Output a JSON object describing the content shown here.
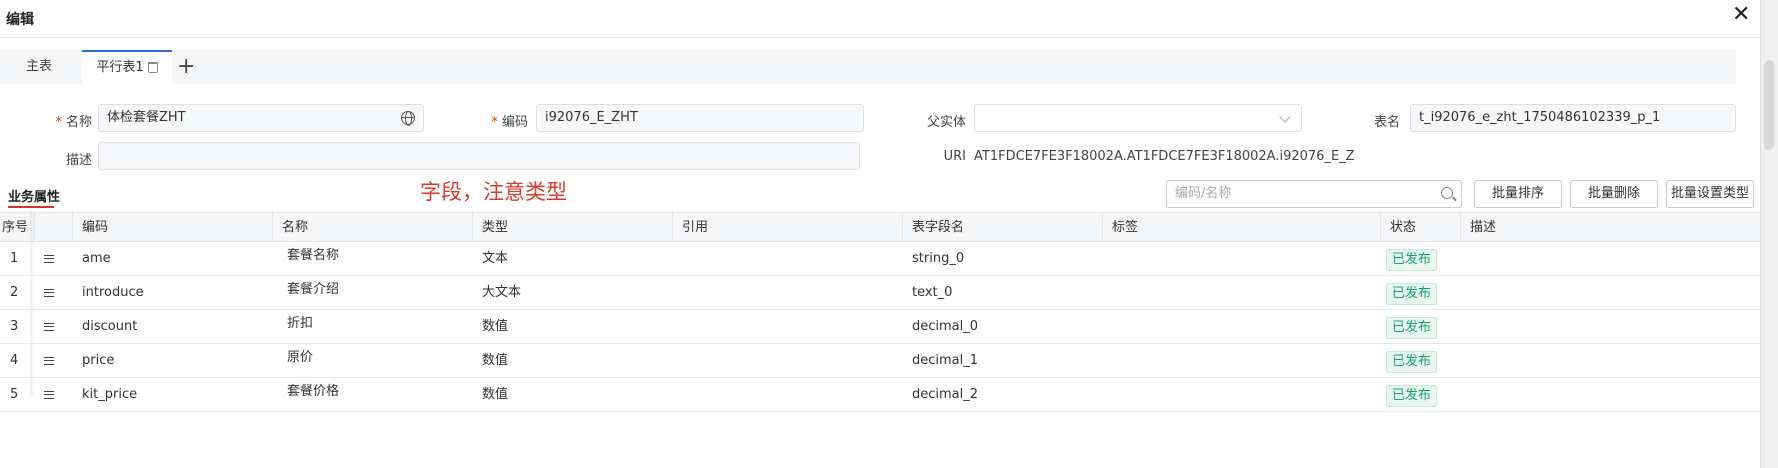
{
  "dialog": {
    "title": "编辑"
  },
  "tabs": {
    "main": "主表",
    "parallel": "平行表1"
  },
  "form": {
    "name_label": "名称",
    "name_value": "体检套餐ZHT",
    "code_label": "编码",
    "code_value": "i92076_E_ZHT",
    "parent_label": "父实体",
    "parent_value": "",
    "table_label": "表名",
    "table_value": "t_i92076_e_zht_1750486102339_p_1",
    "desc_label": "描述",
    "desc_value": "",
    "uri_label": "URI",
    "uri_value": "AT1FDCE7FE3F18002A.AT1FDCE7FE3F18002A.i92076_E_Z"
  },
  "section": {
    "tab": "业务属性",
    "annotation": "字段，注意类型"
  },
  "toolbar": {
    "search_placeholder": "编码/名称",
    "sort_label": "批量排序",
    "delete_label": "批量删除",
    "settype_label": "批量设置类型"
  },
  "table": {
    "headers": {
      "seq": "序号",
      "code": "编码",
      "name": "名称",
      "type": "类型",
      "ref": "引用",
      "field": "表字段名",
      "tag": "标签",
      "status": "状态",
      "desc": "描述"
    },
    "rows": [
      {
        "seq": "1",
        "code": "ame",
        "name": "套餐名称",
        "type": "文本",
        "ref": "",
        "field": "string_0",
        "tag": "",
        "status": "已发布",
        "desc": ""
      },
      {
        "seq": "2",
        "code": "introduce",
        "name": "套餐介绍",
        "type": "大文本",
        "ref": "",
        "field": "text_0",
        "tag": "",
        "status": "已发布",
        "desc": ""
      },
      {
        "seq": "3",
        "code": "discount",
        "name": "折扣",
        "type": "数值",
        "ref": "",
        "field": "decimal_0",
        "tag": "",
        "status": "已发布",
        "desc": ""
      },
      {
        "seq": "4",
        "code": "price",
        "name": "原价",
        "type": "数值",
        "ref": "",
        "field": "decimal_1",
        "tag": "",
        "status": "已发布",
        "desc": ""
      },
      {
        "seq": "5",
        "code": "kit_price",
        "name": "套餐价格",
        "type": "数值",
        "ref": "",
        "field": "decimal_2",
        "tag": "",
        "status": "已发布",
        "desc": ""
      }
    ]
  },
  "colors": {
    "accent": "#2c6fd6",
    "required": "#e0301e",
    "annotation": "#d93a2b",
    "status": "#1aa36b"
  }
}
